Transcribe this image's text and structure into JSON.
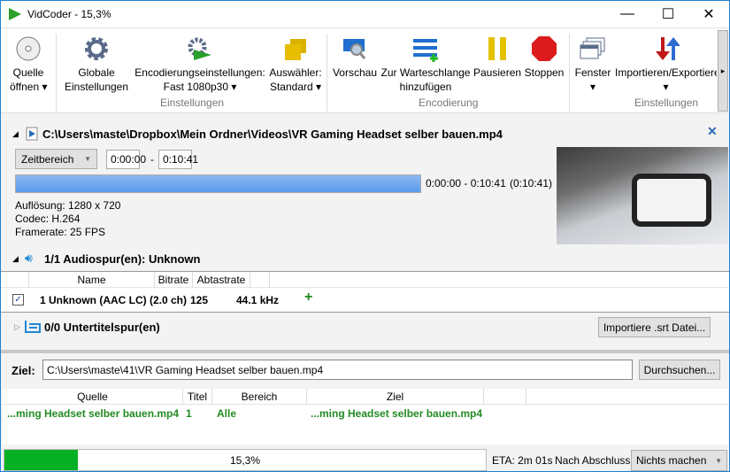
{
  "window": {
    "title": "VidCoder - 15,3%",
    "min": "—",
    "max": "☐",
    "close": "✕"
  },
  "toolbar": {
    "open_source": [
      "Quelle",
      "öffnen ▾"
    ],
    "global_settings": [
      "Globale",
      "Einstellungen"
    ],
    "encoding_settings": [
      "Encodierungseinstellungen:",
      "Fast 1080p30 ▾"
    ],
    "picker": [
      "Auswähler:",
      "Standard ▾"
    ],
    "preview": "Vorschau",
    "add_queue": [
      "Zur Warteschlange",
      "hinzufügen"
    ],
    "pause": "Pausieren",
    "stop": "Stoppen",
    "windows": [
      "Fenster",
      "▾"
    ],
    "import_export": [
      "Importieren/Exportieren",
      "▾"
    ],
    "more": "▸",
    "groups": [
      "Einstellungen",
      "Encodierung",
      "Einstellungen"
    ]
  },
  "source": {
    "path": "C:\\Users\\maste\\Dropbox\\Mein Ordner\\Videos\\VR Gaming Headset selber bauen.mp4",
    "range_type": "Zeitbereich",
    "start": "0:00:00",
    "dash": "-",
    "end": "0:10:41",
    "range_text": "0:00:00 - 0:10:41",
    "duration": "(0:10:41)",
    "resolution": "Auflösung: 1280 x 720",
    "codec": "Codec: H.264",
    "framerate": "Framerate: 25  FPS",
    "close": "✕"
  },
  "audio": {
    "header": "1/1 Audiospur(en): Unknown",
    "columns": [
      "Name",
      "Bitrate",
      "Abtastrate"
    ],
    "row": {
      "name": "1 Unknown (AAC LC) (2.0 ch)",
      "bitrate": "125",
      "samplerate": "44.1 kHz",
      "add": "+"
    }
  },
  "subtitles": {
    "header": "0/0 Untertitelspur(en)",
    "import_button": "Importiere .srt Datei..."
  },
  "destination": {
    "label": "Ziel:",
    "value": "C:\\Users\\maste\\41\\VR Gaming Headset selber bauen.mp4",
    "browse": "Durchsuchen..."
  },
  "queue": {
    "columns": [
      "Quelle",
      "Titel",
      "Bereich",
      "Ziel"
    ],
    "rows": [
      {
        "source": "...ming Headset selber bauen.mp4",
        "title": "1",
        "range": "Alle",
        "dest": "...ming Headset selber bauen.mp4"
      }
    ]
  },
  "status": {
    "progress_percent": 15.3,
    "progress_text": "15,3%",
    "eta": "ETA: 2m 01s",
    "after_label": "Nach Abschluss",
    "after_value": "Nichts machen"
  }
}
